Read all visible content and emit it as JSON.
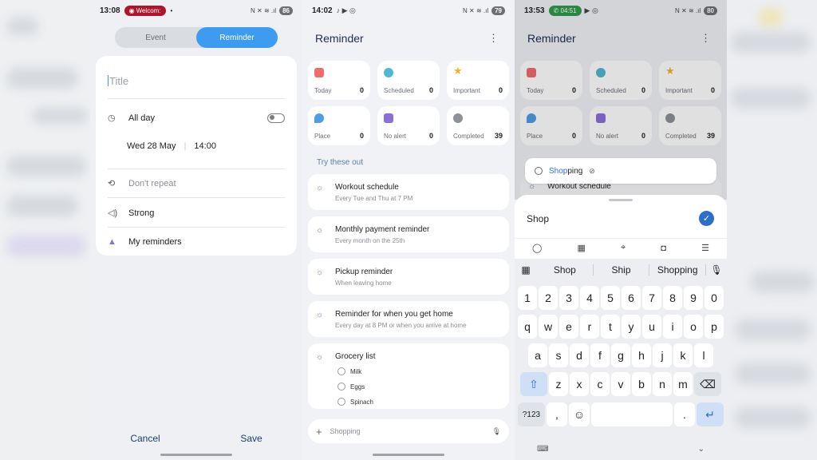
{
  "screen_left": {
    "status": {
      "time": "13:08",
      "notif": "Welcom:",
      "dot": "•",
      "battery": "86",
      "icons": "N ✕ ≋ .ıl"
    },
    "tabs": [
      {
        "label": "Event"
      },
      {
        "label": "Reminder"
      }
    ],
    "title_placeholder": "Title",
    "all_day_label": "All day",
    "date": "Wed 28 May",
    "time": "14:00",
    "repeat_label": "Don't repeat",
    "sound_label": "Strong",
    "list_label": "My reminders",
    "cancel_label": "Cancel",
    "save_label": "Save"
  },
  "screen_mid": {
    "status": {
      "time": "14:02",
      "icons": "N ✕ ≋ .ıl",
      "battery": "79"
    },
    "title": "Reminder",
    "tiles": [
      {
        "label": "Today",
        "count": "0",
        "color": "#f06b6b"
      },
      {
        "label": "Scheduled",
        "count": "0",
        "color": "#4fb8d4"
      },
      {
        "label": "Important",
        "count": "0",
        "color": "#f2b324"
      },
      {
        "label": "Place",
        "count": "0",
        "color": "#4e9ee6"
      },
      {
        "label": "No alert",
        "count": "0",
        "color": "#8a6fd9"
      },
      {
        "label": "Completed",
        "count": "39",
        "color": "#8e9196"
      }
    ],
    "section_label": "Try these out",
    "suggestions": [
      {
        "title": "Workout schedule",
        "sub": "Every Tue and Thu at 7 PM"
      },
      {
        "title": "Monthly payment reminder",
        "sub": "Every month on the 25th"
      },
      {
        "title": "Pickup reminder",
        "sub": "When leaving home"
      },
      {
        "title": "Reminder for when you get home",
        "sub": "Every day at 8 PM or when you arrive at home"
      }
    ],
    "grocery": {
      "title": "Grocery list",
      "items": [
        "Milk",
        "Eggs",
        "Spinach"
      ]
    },
    "add_placeholder": "Shopping"
  },
  "screen_right": {
    "status": {
      "time": "13:53",
      "call": "04:51",
      "icons": "N ✕ ≋ .ıl",
      "battery": "80"
    },
    "title": "Reminder",
    "tiles": [
      {
        "label": "Today",
        "count": "0"
      },
      {
        "label": "Scheduled",
        "count": "0"
      },
      {
        "label": "Important",
        "count": "0"
      },
      {
        "label": "Place",
        "count": "0"
      },
      {
        "label": "No alert",
        "count": "0"
      },
      {
        "label": "Completed",
        "count": "39"
      }
    ],
    "input_hl": "Shop",
    "input_rest": "ping",
    "peek_item": "Workout schedule",
    "sheet_text": "Shop",
    "predictions": [
      "Shop",
      "Ship",
      "Shopping"
    ],
    "row_numbers": [
      "1",
      "2",
      "3",
      "4",
      "5",
      "6",
      "7",
      "8",
      "9",
      "0"
    ],
    "row_q": [
      "q",
      "w",
      "e",
      "r",
      "t",
      "y",
      "u",
      "i",
      "o",
      "p"
    ],
    "row_a": [
      "a",
      "s",
      "d",
      "f",
      "g",
      "h",
      "j",
      "k",
      "l"
    ],
    "row_z": [
      "z",
      "x",
      "c",
      "v",
      "b",
      "n",
      "m"
    ],
    "sym_label": "?123",
    "comma": ",",
    "period": "."
  }
}
